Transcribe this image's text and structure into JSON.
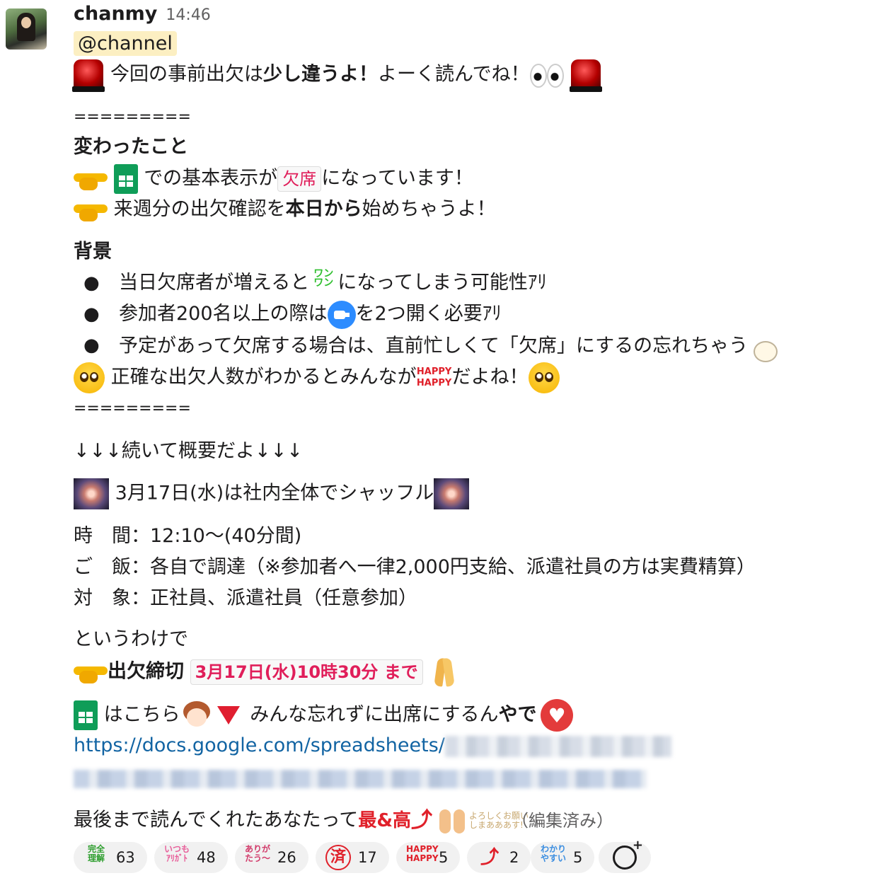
{
  "message": {
    "sender": "chanmy",
    "time": "14:46",
    "mention": "@channel",
    "intro_pre": "今回の事前出欠は",
    "intro_bold": "少し違うよ！",
    "intro_post": "よーく読んでね！",
    "divider": "=========",
    "changes": {
      "heading": "変わったこと",
      "item1_pre": "での基本表示が",
      "item1_code": "欠席",
      "item1_post": "になっています！",
      "item2_pre": "来週分の出欠確認を",
      "item2_bold": "本日から",
      "item2_post": "始めちゃうよ！"
    },
    "background": {
      "heading": "背景",
      "bullets": [
        {
          "pre": "当日欠席者が増えると",
          "post": "になってしまう可能性ｱﾘ"
        },
        {
          "pre": "参加者200名以上の際は",
          "post": "を2つ開く必要ｱﾘ"
        },
        {
          "pre": "予定があって欠席する場合は、直前忙しくて「欠席」にするの忘れちゃう",
          "post": ""
        }
      ],
      "closing_pre": "正確な出欠人数がわかるとみんなが",
      "closing_post": "だよね！"
    },
    "overview_line": "↓↓↓続いて概要だよ↓↓↓",
    "event_title": "3月17日(水)は社内全体でシャッフル",
    "details": [
      "時　間：12:10〜(40分間)",
      "ご　飯：各自で調達（※参加者へ一律2,000円支給、派遣社員の方は実費精算）",
      "対　象：正社員、派遣社員（任意参加）"
    ],
    "so_line": "というわけで",
    "deadline_label": "出欠締切",
    "deadline_value": "3月17日(水)10時30分 まで",
    "sheet_line_pre": "はこちら",
    "sheet_line_post": "みんな忘れずに出席にするん",
    "sheet_line_yade": "やで",
    "link_text": "https://docs.google.com/spreadsheets/",
    "final_line": "最後まで読んでくれたあなたって",
    "saiko": "最&高",
    "edited": "（編集済み）"
  },
  "emoji_text": {
    "wanwan": "ワン\nワン",
    "happy": "HAPPY\nHAPPY",
    "yoroshiku": "よろしくお願い\nしまあああす!"
  },
  "reactions": [
    {
      "icon_name": "kanzen-rikai-icon",
      "icon_text": "完全\n理解",
      "count": "63",
      "color": "#2e9e2e"
    },
    {
      "icon_name": "itsumo-arigato-icon",
      "icon_text": "いつも\nｱﾘｶﾞﾄ",
      "count": "48",
      "color": "#e85f9a"
    },
    {
      "icon_name": "arigatou-icon",
      "icon_text": "ありが\nたう〜",
      "count": "26",
      "color": "#d23a6a"
    },
    {
      "icon_name": "sumi-stamp-icon",
      "icon_text": "済",
      "count": "17",
      "color": "#e0202a"
    },
    {
      "icon_name": "happy-happy-icon",
      "icon_text": "HAPPY\nHAPPY",
      "count": "5",
      "color": "#e0202a"
    },
    {
      "icon_name": "red-up-arrow-icon",
      "icon_text": "⤴",
      "count": "2",
      "color": "#e0202a"
    },
    {
      "icon_name": "wakari-yasui-icon",
      "icon_text": "わかり\nやすい",
      "count": "5",
      "color": "#3a8de0"
    }
  ],
  "colors": {
    "mention_bg": "#fcefc2",
    "code_text": "#e01e5a",
    "link": "#1264a3",
    "reaction_bg": "#f1f1f1"
  }
}
